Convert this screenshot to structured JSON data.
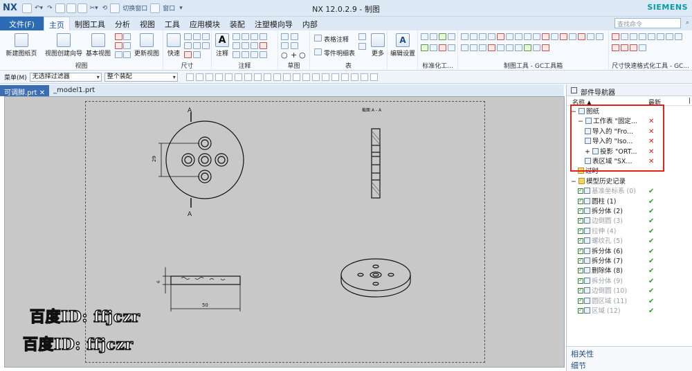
{
  "titlebar": {
    "logo": "NX",
    "switch_window": "切换窗口",
    "window_menu": "窗口",
    "title": "NX 12.0.2.9 - 制图",
    "brand": "SIEMENS"
  },
  "tabs": {
    "file": "文件(F)",
    "items": [
      "主页",
      "制图工具",
      "分析",
      "视图",
      "工具",
      "应用模块",
      "装配",
      "注塑模向导",
      "内部"
    ],
    "search_placeholder": "查找命令"
  },
  "ribbon": {
    "new_sheet": "新建图纸页",
    "view_wizard": "视图创建向导",
    "base_view": "基本视图",
    "update_views": "更新视图",
    "group_view": "视图",
    "quick": "快速",
    "group_dimension": "尺寸",
    "annotation": "注释",
    "group_annotation": "注释",
    "group_sketch": "草图",
    "table_note": "表格注释",
    "parts_list": "零件明细表",
    "more": "更多",
    "group_table": "表",
    "edit_settings": "编辑设置",
    "group_standardize": "标准化工...",
    "group_gc_drafting": "制图工具 - GC工具箱",
    "group_quick_dim": "尺寸快速格式化工具 - GC..."
  },
  "selection_bar": {
    "menu": "菜单(M)",
    "filter": "无选择过滤器",
    "scope": "整个装配"
  },
  "doc_tabs": [
    {
      "label": "可调脚.prt",
      "active": true
    },
    {
      "label": "_model1.prt",
      "active": false
    }
  ],
  "drawing": {
    "section_label_top": "A",
    "section_label_bottom": "A",
    "section_title": "截面 A - A",
    "dim_vertical": "29",
    "dim_thickness": "6",
    "dim_width": "50"
  },
  "navigator": {
    "title": "部件导航器",
    "col_name": "名称",
    "col_updated": "最新",
    "rows": [
      {
        "label": "图纸",
        "status": "",
        "indent": 0
      },
      {
        "label": "工作表 \"固定...",
        "status": "x",
        "indent": 1
      },
      {
        "label": "导入的 \"Fro...",
        "status": "x",
        "indent": 2
      },
      {
        "label": "导入的 \"Iso...",
        "status": "x",
        "indent": 2
      },
      {
        "label": "投影 \"ORT...",
        "status": "x",
        "indent": 2
      },
      {
        "label": "表区域 \"SX...",
        "status": "x",
        "indent": 2
      },
      {
        "label": "过时",
        "status": "",
        "indent": 1
      },
      {
        "label": "模型历史记录",
        "status": "",
        "indent": 0
      },
      {
        "label": "基准坐标系 (0)",
        "status": "ok",
        "indent": 1,
        "dim": true
      },
      {
        "label": "圆柱 (1)",
        "status": "ok",
        "indent": 1
      },
      {
        "label": "拆分体 (2)",
        "status": "ok",
        "indent": 1
      },
      {
        "label": "边倒圆 (3)",
        "status": "ok",
        "indent": 1,
        "dim": true
      },
      {
        "label": "拉伸 (4)",
        "status": "ok",
        "indent": 1,
        "dim": true
      },
      {
        "label": "螺纹孔 (5)",
        "status": "ok",
        "indent": 1,
        "dim": true
      },
      {
        "label": "拆分体 (6)",
        "status": "ok",
        "indent": 1
      },
      {
        "label": "拆分体 (7)",
        "status": "ok",
        "indent": 1
      },
      {
        "label": "删除体 (8)",
        "status": "ok",
        "indent": 1
      },
      {
        "label": "拆分体 (9)",
        "status": "ok",
        "indent": 1,
        "dim": true
      },
      {
        "label": "边倒圆 (10)",
        "status": "ok",
        "indent": 1,
        "dim": true
      },
      {
        "label": "圆区域 (11)",
        "status": "ok",
        "indent": 1,
        "dim": true
      },
      {
        "label": "区域 (12)",
        "status": "ok",
        "indent": 1,
        "dim": true
      }
    ],
    "footer_dependencies": "相关性",
    "footer_details": "细节"
  },
  "watermark": "百度ID: ffjczr"
}
